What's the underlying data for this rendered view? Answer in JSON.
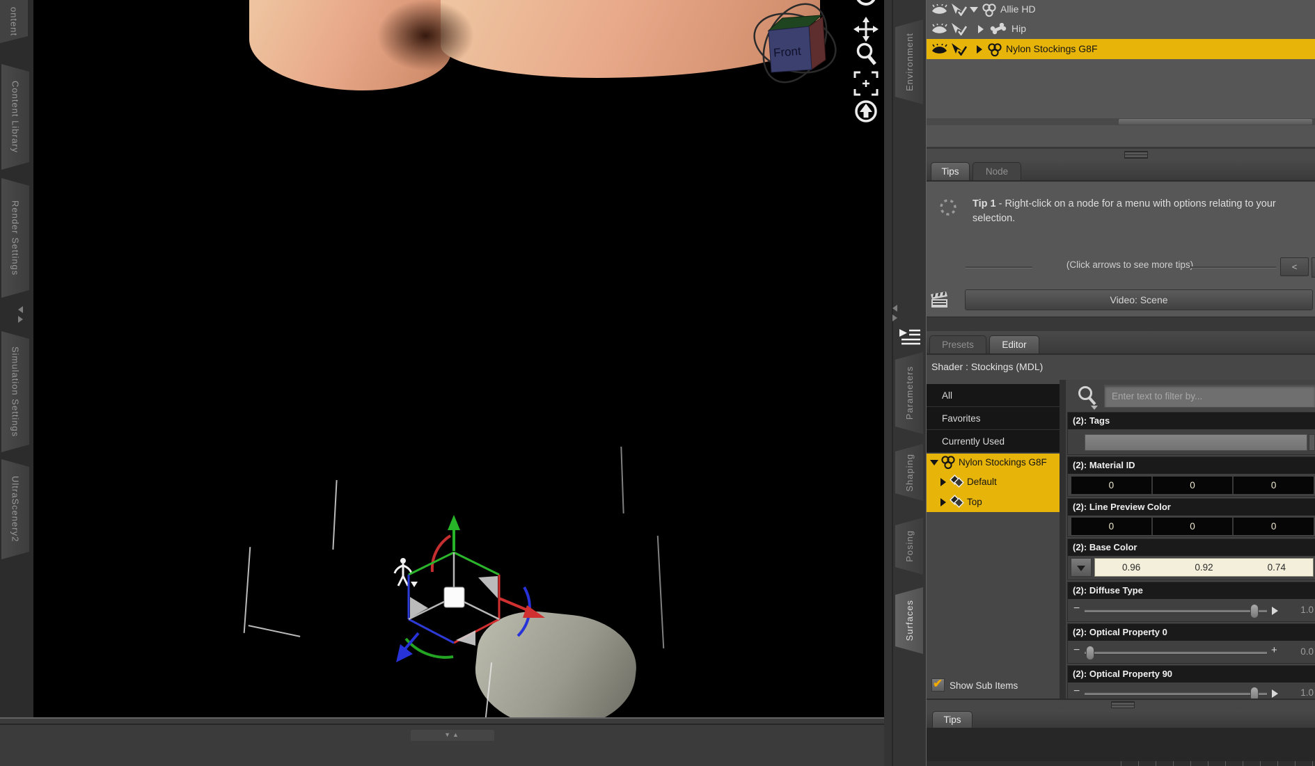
{
  "left_sidebar": {
    "tabs": [
      "ontent",
      "Content Library",
      "Render Settings",
      "Simulation Settings",
      "UltraScenery2"
    ]
  },
  "viewport": {
    "view_cube_front": "Front"
  },
  "dock_tabs": {
    "environment": "Environment",
    "parameters": "Parameters",
    "shaping": "Shaping",
    "posing": "Posing",
    "surfaces": "Surfaces"
  },
  "scene_pane": {
    "nodes": [
      {
        "label": "Allie HD"
      },
      {
        "label": "Hip"
      },
      {
        "label": "Nylon Stockings G8F"
      }
    ]
  },
  "tips_pane": {
    "tab_tips": "Tips",
    "tab_node": "Node",
    "tip_title": "Tip 1",
    "tip_body": " - Right-click on a node for a menu with options relating to your selection.",
    "arrows_hint": "(Click arrows to see more tips)",
    "prev_arrow": "<",
    "video_button": "Video: Scene"
  },
  "surfaces_pane": {
    "tab_presets": "Presets",
    "tab_editor": "Editor",
    "shader_label": "Shader : Stockings (MDL)",
    "filter_placeholder": "Enter text to filter by...",
    "filter_value": "",
    "list": [
      "All",
      "Favorites",
      "Currently Used"
    ],
    "tree_root": "Nylon Stockings G8F",
    "tree_children": [
      "Default",
      "Top"
    ],
    "show_sub_items_label": "Show Sub Items",
    "groups": {
      "tags": {
        "label": "(2): Tags",
        "value": ""
      },
      "material_id": {
        "label": "(2): Material ID",
        "v1": "0",
        "v2": "0",
        "v3": "0"
      },
      "line_preview": {
        "label": "(2): Line Preview Color",
        "v1": "0",
        "v2": "0",
        "v3": "0"
      },
      "base_color": {
        "label": "(2): Base Color",
        "v1": "0.96",
        "v2": "0.92",
        "v3": "0.74"
      },
      "diffuse": {
        "label": "(2): Diffuse Type",
        "value": "1.0"
      },
      "optical0": {
        "label": "(2): Optical Property 0",
        "value": "0.0"
      },
      "optical90": {
        "label": "(2): Optical Property 90",
        "value": "1.0"
      }
    }
  },
  "bottom_pane": {
    "tab_tips": "Tips"
  },
  "colors": {
    "selection_yellow": "#e7b40a",
    "check_orange": "#f2a900",
    "base_color_bar": "#f4efda",
    "axis_x_red": "#d03030",
    "axis_y_green": "#28b428",
    "axis_z_blue": "#2733d8"
  }
}
